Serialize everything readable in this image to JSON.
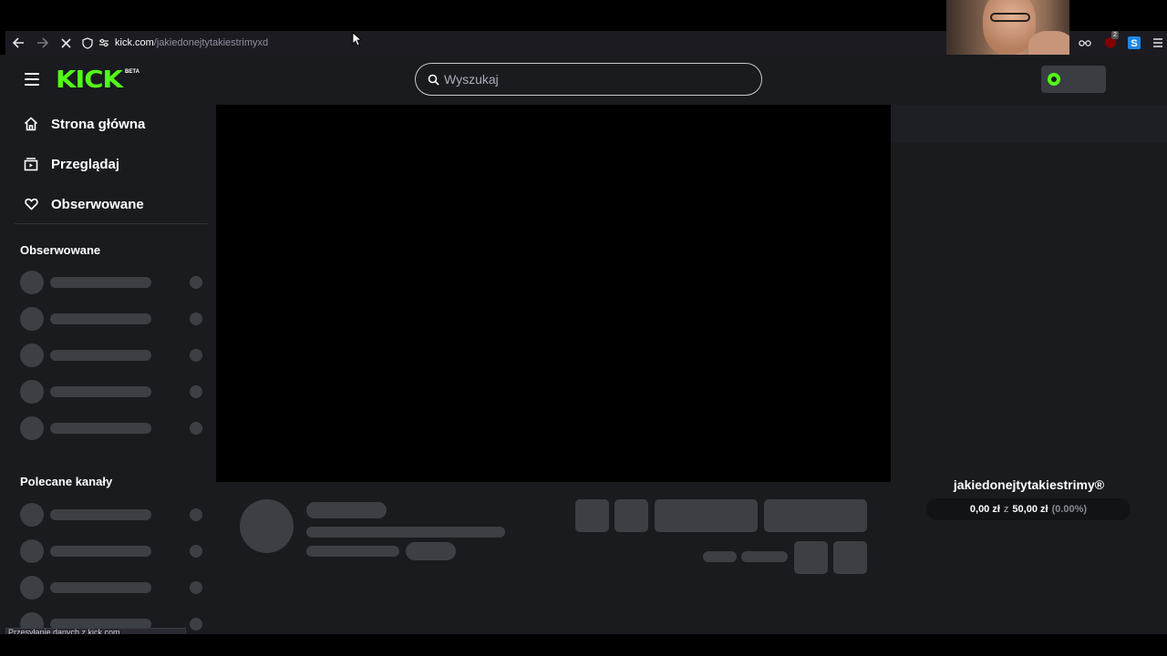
{
  "browser": {
    "url_domain": "kick.com",
    "url_path": "/jakiedonejtytakiestrimyxd",
    "status_text": "Przesyłanie danych z kick.com",
    "extension_badge": "2"
  },
  "header": {
    "logo_text": "KICK",
    "logo_badge": "BETA",
    "search_placeholder": "Wyszukaj",
    "accent_color": "#53fc18"
  },
  "sidebar": {
    "nav": [
      {
        "label": "Strona główna",
        "icon": "home-icon"
      },
      {
        "label": "Przeglądaj",
        "icon": "browse-icon"
      },
      {
        "label": "Obserwowane",
        "icon": "heart-icon"
      }
    ],
    "following_title": "Obserwowane",
    "recommended_title": "Polecane kanały"
  },
  "channel": {
    "name": "jakiedonejtytakiestrimy®",
    "goal_current": "0,00 zł",
    "goal_separator": "z",
    "goal_target": "50,00 zł",
    "goal_percent": "(0.00%)"
  }
}
